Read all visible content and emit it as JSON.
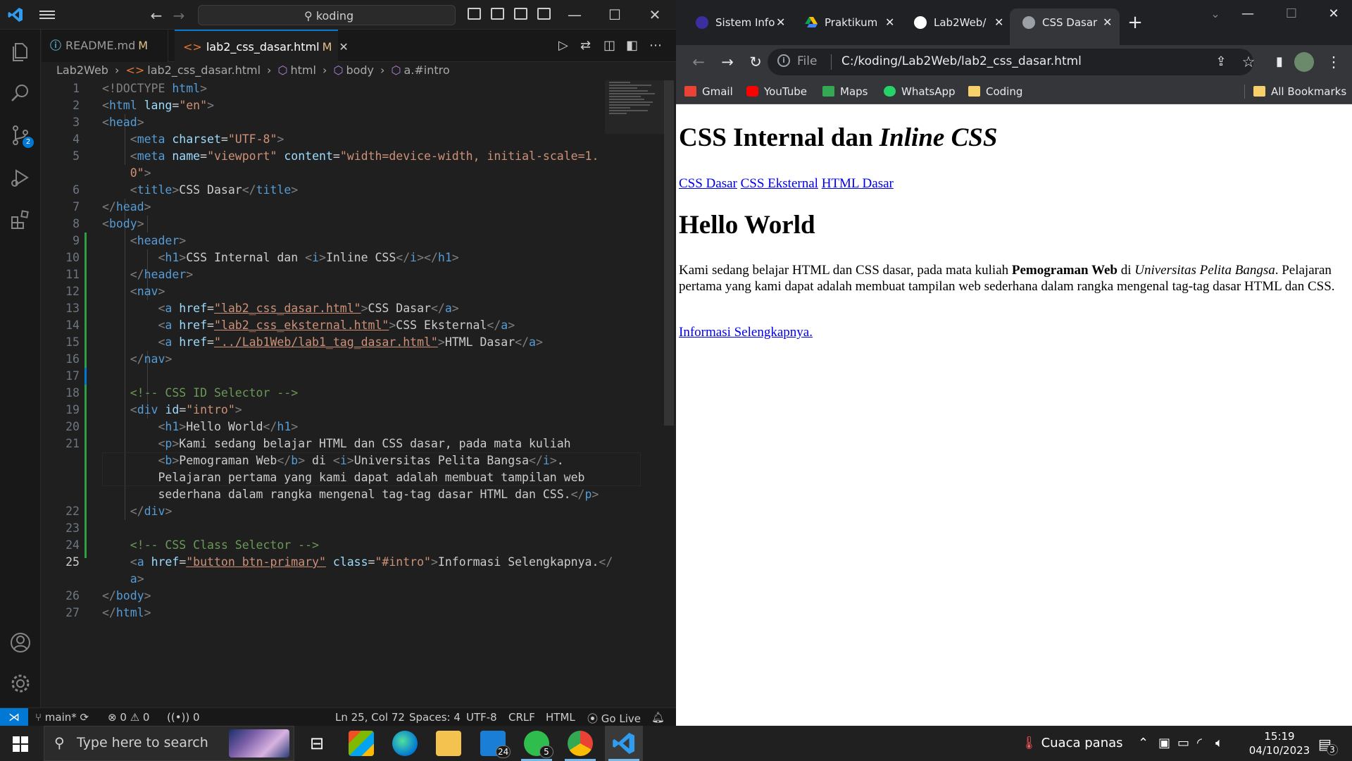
{
  "vscode": {
    "search_text": "koding",
    "tabs": [
      {
        "name": "README.md",
        "status": "M"
      },
      {
        "name": "lab2_css_dasar.html",
        "status": "M"
      }
    ],
    "breadcrumb": [
      "Lab2Web",
      "lab2_css_dasar.html",
      "html",
      "body",
      "a.#intro"
    ],
    "scm_badge": "2",
    "line_numbers": [
      "1",
      "2",
      "3",
      "4",
      "5",
      "",
      "6",
      "7",
      "8",
      "9",
      "10",
      "11",
      "12",
      "13",
      "14",
      "15",
      "16",
      "17",
      "18",
      "19",
      "20",
      "21",
      "",
      "",
      "",
      "22",
      "23",
      "24",
      "25",
      "",
      "26",
      "27"
    ],
    "status": {
      "branch": "main*",
      "errors": "0",
      "warnings": "0",
      "ports": "0",
      "position": "Ln 25, Col 72",
      "spaces": "Spaces: 4",
      "encoding": "UTF-8",
      "eol": "CRLF",
      "language": "HTML",
      "golive": "Go Live"
    }
  },
  "code": {
    "l1_a": "<!DOCTYPE",
    "l1_b": " html",
    "l1_c": ">",
    "l2_attr": "lang",
    "l2_val": "\"en\"",
    "l4_attr": "charset",
    "l4_val": "\"UTF-8\"",
    "l5_attr1": "name",
    "l5_val1": "\"viewport\"",
    "l5_attr2": "content",
    "l5_val2a": "\"width=device-width, initial-scale=1.",
    "l5_val2b": "0\"",
    "l6_text": "CSS Dasar",
    "l10_text1": "CSS Internal dan ",
    "l10_text2": "Inline CSS",
    "l13_href": "\"lab2_css_dasar.html\"",
    "l13_text": "CSS Dasar",
    "l14_href": "\"lab2_css_eksternal.html\"",
    "l14_text": "CSS Eksternal",
    "l15_href": "\"../Lab1Web/lab1_tag_dasar.html\"",
    "l15_text": "HTML Dasar",
    "l18_comment": "<!-- CSS ID Selector -->",
    "l19_id": "\"intro\"",
    "l20_text": "Hello World",
    "l21_text1": "Kami sedang belajar HTML dan CSS dasar, pada mata kuliah",
    "l21_b": "Pemograman Web",
    "l21_di": " di ",
    "l21_i": "Universitas Pelita Bangsa",
    "l21_dot": ".",
    "l21_text2": "Pelajaran pertama yang kami dapat adalah membuat tampilan web",
    "l21_text3": "sederhana dalam rangka mengenal tag-tag dasar HTML dan CSS.",
    "l24_comment": "<!-- CSS Class Selector -->",
    "l25_href": "\"button btn-primary\"",
    "l25_class": "\"#intro\"",
    "l25_text": "Informasi Selengkapnya."
  },
  "chrome": {
    "tabs": [
      "Sistem Info",
      "Praktikum",
      "Lab2Web/",
      "CSS Dasar"
    ],
    "omnibox_scheme": "File",
    "url": "C:/koding/Lab2Web/lab2_css_dasar.html",
    "bookmarks": [
      "Gmail",
      "YouTube",
      "Maps",
      "WhatsApp",
      "Coding"
    ],
    "all_bookmarks": "All Bookmarks"
  },
  "page": {
    "title_plain": "CSS Internal dan ",
    "title_italic": "Inline CSS",
    "nav_links": [
      "CSS Dasar",
      "CSS Eksternal",
      "HTML Dasar"
    ],
    "heading": "Hello World",
    "para_1": "Kami sedang belajar HTML dan CSS dasar, pada mata kuliah ",
    "para_bold": "Pemograman Web",
    "para_di": " di ",
    "para_italic": "Universitas Pelita Bangsa",
    "para_2": ". Pelajaran pertama yang kami dapat adalah membuat tampilan web sederhana dalam rangka mengenal tag-tag dasar HTML dan CSS.",
    "more_link": "Informasi Selengkapnya."
  },
  "taskbar": {
    "search_placeholder": "Type here to search",
    "mail_badge": "24",
    "whatsapp_badge": "5",
    "weather": "Cuaca panas",
    "time": "15:19",
    "date": "04/10/2023",
    "notification_badge": "3"
  }
}
